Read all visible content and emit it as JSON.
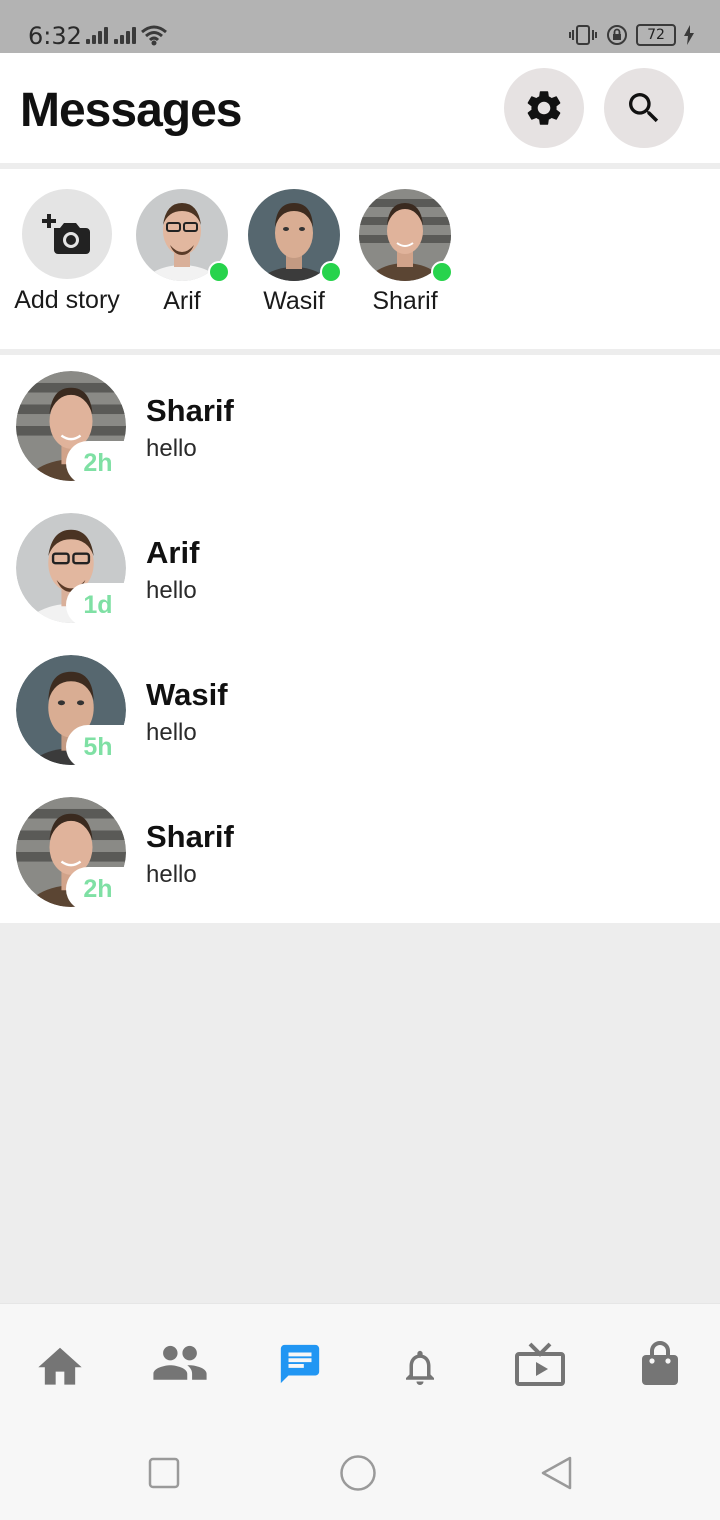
{
  "status_bar": {
    "time": "6:32",
    "battery": "72"
  },
  "header": {
    "title": "Messages",
    "settings_icon": "gear-icon",
    "search_icon": "search-icon"
  },
  "stories": [
    {
      "label": "Add story",
      "icon": "add-photo-icon"
    },
    {
      "label": "Arif",
      "online": true
    },
    {
      "label": "Wasif",
      "online": true
    },
    {
      "label": "Sharif",
      "online": true
    }
  ],
  "messages": [
    {
      "name": "Sharif",
      "text": "hello",
      "time": "2h"
    },
    {
      "name": "Arif",
      "text": "hello",
      "time": "1d"
    },
    {
      "name": "Wasif",
      "text": "hello",
      "time": "5h"
    },
    {
      "name": "Sharif",
      "text": "hello",
      "time": "2h"
    }
  ],
  "bottom_nav": [
    {
      "icon": "home-icon"
    },
    {
      "icon": "friends-icon"
    },
    {
      "icon": "messages-icon",
      "active": true
    },
    {
      "icon": "bell-icon"
    },
    {
      "icon": "tv-icon"
    },
    {
      "icon": "shopping-bag-icon"
    }
  ],
  "colors": {
    "accent": "#2196f3",
    "online": "#27d34c",
    "time_badge": "#7fe0a4",
    "icon_inactive": "#757575"
  }
}
